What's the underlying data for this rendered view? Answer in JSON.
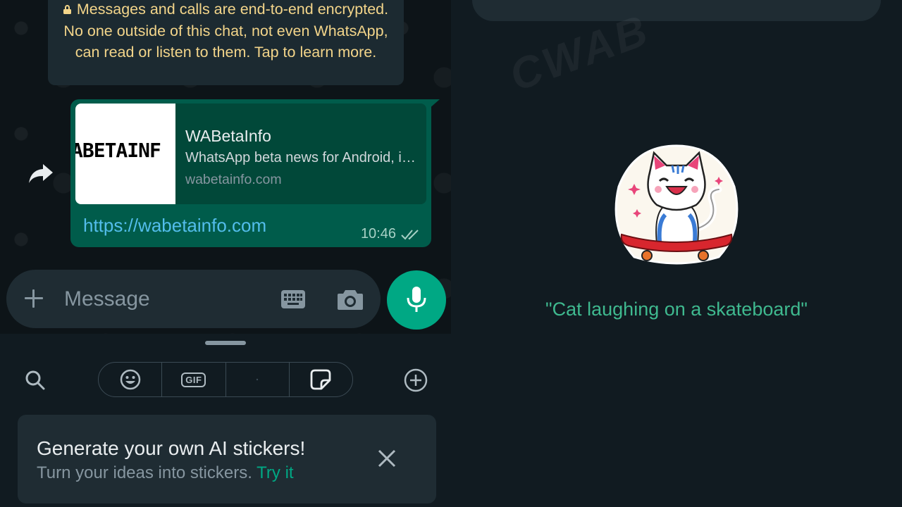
{
  "chat": {
    "encryption_notice": "Messages and calls are end-to-end encrypted. No one outside of this chat, not even WhatsApp, can read or listen to them. Tap to learn more.",
    "message": {
      "preview_image_text": "ABETAINF",
      "preview_title": "WABetaInfo",
      "preview_description": "WhatsApp beta news for Android, iOS, Desktop and Web",
      "preview_domain": "wabetainfo.com",
      "link_text": "https://wabetainfo.com",
      "time": "10:46",
      "status": "read"
    },
    "composer": {
      "placeholder": "Message"
    }
  },
  "tray": {
    "tabs": [
      {
        "name": "emoji",
        "icon": "emoji-icon"
      },
      {
        "name": "gif",
        "label": "GIF"
      },
      {
        "name": "avatar",
        "icon": "avatar-icon"
      },
      {
        "name": "stickers",
        "icon": "sticker-icon",
        "selected": true
      }
    ],
    "promo": {
      "title": "Generate your own AI stickers!",
      "subtitle": "Turn your ideas into stickers.",
      "link": "Try it"
    }
  },
  "right": {
    "caption": "\"Cat laughing on a skateboard\"",
    "watermark": "CWAB"
  },
  "colors": {
    "accent": "#00a884",
    "outgoing_bubble": "#005c4b",
    "link": "#53bdeb",
    "notice_text": "#f3d58a",
    "caption": "#3fb98f",
    "background": "#111b21"
  }
}
